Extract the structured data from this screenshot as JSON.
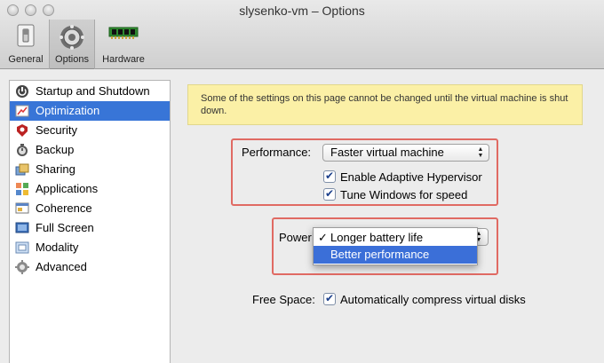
{
  "window": {
    "title": "slysenko-vm – Options"
  },
  "toolbar": {
    "general_label": "General",
    "options_label": "Options",
    "hardware_label": "Hardware"
  },
  "sidebar": {
    "items": [
      {
        "label": "Startup and Shutdown",
        "icon": "power-icon"
      },
      {
        "label": "Optimization",
        "icon": "gauge-icon",
        "selected": true
      },
      {
        "label": "Security",
        "icon": "shield-icon"
      },
      {
        "label": "Backup",
        "icon": "backup-icon"
      },
      {
        "label": "Sharing",
        "icon": "sharing-icon"
      },
      {
        "label": "Applications",
        "icon": "applications-icon"
      },
      {
        "label": "Coherence",
        "icon": "coherence-icon"
      },
      {
        "label": "Full Screen",
        "icon": "fullscreen-icon"
      },
      {
        "label": "Modality",
        "icon": "modality-icon"
      },
      {
        "label": "Advanced",
        "icon": "gear-icon"
      }
    ]
  },
  "notice": {
    "text": "Some of the settings on this page cannot be changed until the virtual machine is shut down."
  },
  "performance": {
    "label": "Performance:",
    "value": "Faster virtual machine",
    "adaptive_hypervisor_label": "Enable Adaptive Hypervisor",
    "adaptive_hypervisor_checked": true,
    "tune_windows_label": "Tune Windows for speed",
    "tune_windows_checked": true
  },
  "power": {
    "label": "Power:",
    "menu_items": [
      "Longer battery life",
      "Better performance"
    ],
    "checked_item": "Longer battery life",
    "highlighted_item": "Better performance"
  },
  "free_space": {
    "label": "Free Space:",
    "compress_label": "Automatically compress virtual disks",
    "compress_checked": true
  },
  "colors": {
    "selection": "#3875d7",
    "highlight_box": "#e06a63",
    "notice_bg": "#fbf0a6"
  }
}
